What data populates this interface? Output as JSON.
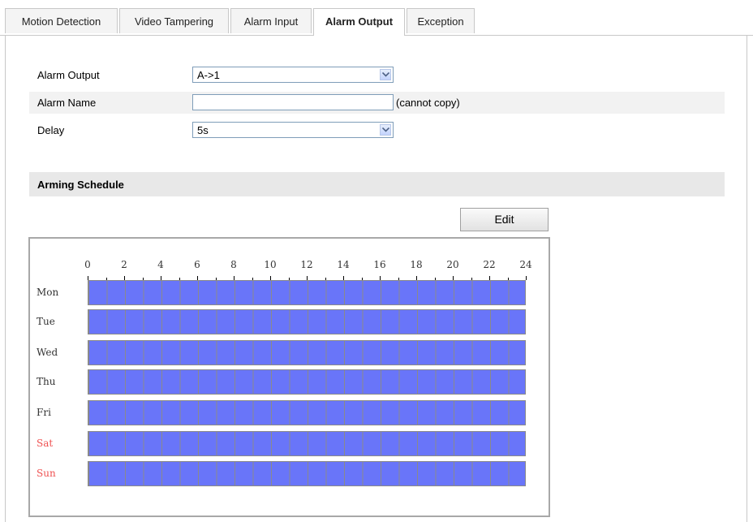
{
  "tabs": [
    {
      "label": "Motion Detection",
      "active": false
    },
    {
      "label": "Video Tampering",
      "active": false
    },
    {
      "label": "Alarm Input",
      "active": false
    },
    {
      "label": "Alarm Output",
      "active": true
    },
    {
      "label": "Exception",
      "active": false
    }
  ],
  "form": {
    "alarm_output": {
      "label": "Alarm Output",
      "value": "A->1"
    },
    "alarm_name": {
      "label": "Alarm Name",
      "value": "",
      "note": "(cannot copy)"
    },
    "delay": {
      "label": "Delay",
      "value": "5s"
    }
  },
  "schedule": {
    "title": "Arming Schedule",
    "edit_label": "Edit",
    "hours": [
      "0",
      "2",
      "4",
      "6",
      "8",
      "10",
      "12",
      "14",
      "16",
      "18",
      "20",
      "22",
      "24"
    ],
    "days": [
      {
        "label": "Mon",
        "weekend": false,
        "armed_fraction": 1.0
      },
      {
        "label": "Tue",
        "weekend": false,
        "armed_fraction": 1.0
      },
      {
        "label": "Wed",
        "weekend": false,
        "armed_fraction": 1.0
      },
      {
        "label": "Thu",
        "weekend": false,
        "armed_fraction": 1.0
      },
      {
        "label": "Fri",
        "weekend": false,
        "armed_fraction": 1.0
      },
      {
        "label": "Sat",
        "weekend": true,
        "armed_fraction": 1.0
      },
      {
        "label": "Sun",
        "weekend": true,
        "armed_fraction": 1.0
      }
    ],
    "colors": {
      "armed": "#6975f9",
      "weekend_label": "#ef5151",
      "grid": "#8a8a8a"
    }
  }
}
